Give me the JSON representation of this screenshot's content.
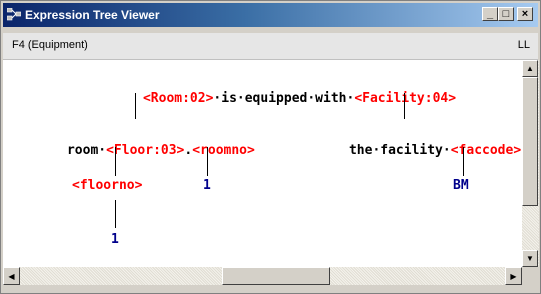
{
  "window": {
    "title": "Expression Tree Viewer",
    "buttons": {
      "minimize": "_",
      "maximize": "□",
      "close": "×"
    }
  },
  "info": {
    "left": "F4 (Equipment)",
    "right": "LL"
  },
  "tree": {
    "root": {
      "v1": "<Room:02>",
      "t1": "·is·equipped·with·",
      "v2": "<Facility:04>"
    },
    "left": {
      "t1": "room·",
      "v1": "<Floor:03>",
      "t2": ".",
      "v2": "<roomno>"
    },
    "right": {
      "t1": "the·facility·",
      "v1": "<faccode>"
    },
    "floorno": "<floorno>",
    "roomno_value": "1",
    "faccode_value": "BM",
    "floorno_value": "1"
  },
  "scrollbars": {
    "up": "▲",
    "down": "▼",
    "left": "◀",
    "right": "▶"
  }
}
